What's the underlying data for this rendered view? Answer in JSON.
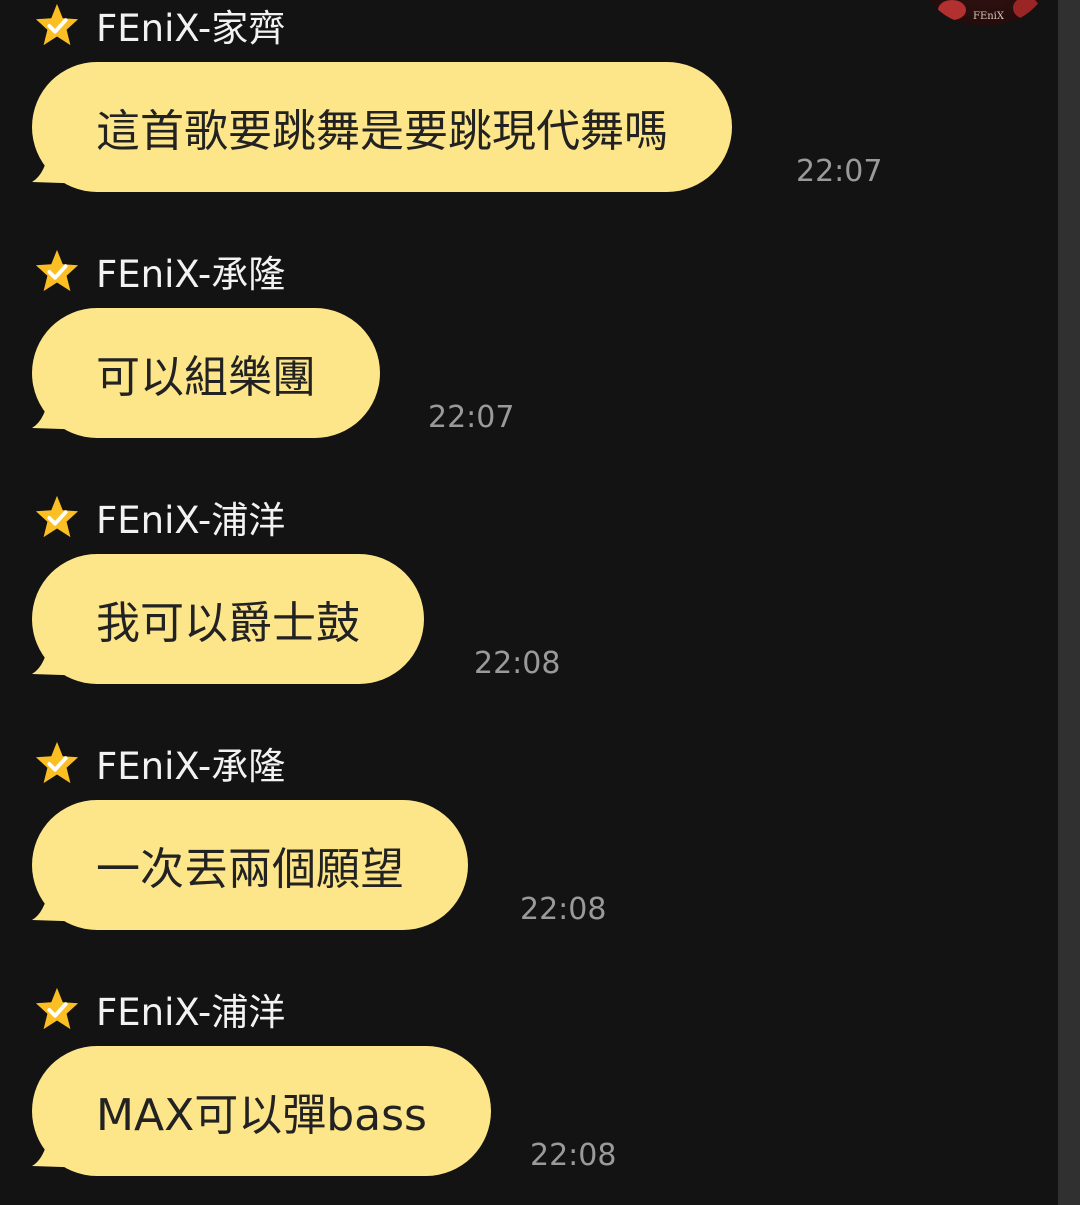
{
  "messages": [
    {
      "sender": "FEniX-家齊",
      "text": "這首歌要跳舞是要跳現代舞嗎",
      "time": "22:07",
      "star_icon": "star-check-icon"
    },
    {
      "sender": "FEniX-承隆",
      "text": "可以組樂團",
      "time": "22:07",
      "star_icon": "star-check-icon"
    },
    {
      "sender": "FEniX-浦洋",
      "text": "我可以爵士鼓",
      "time": "22:08",
      "star_icon": "star-check-icon"
    },
    {
      "sender": "FEniX-承隆",
      "text": "一次丟兩個願望",
      "time": "22:08",
      "star_icon": "star-check-icon"
    },
    {
      "sender": "FEniX-浦洋",
      "text": "MAX可以彈bass",
      "time": "22:08",
      "star_icon": "star-check-icon"
    }
  ],
  "avatar": {
    "logo": "FEniX"
  },
  "colors": {
    "background": "#131313",
    "bubble": "#fde68a",
    "star": "#fbbf24",
    "timestamp": "#9a9a9a"
  }
}
